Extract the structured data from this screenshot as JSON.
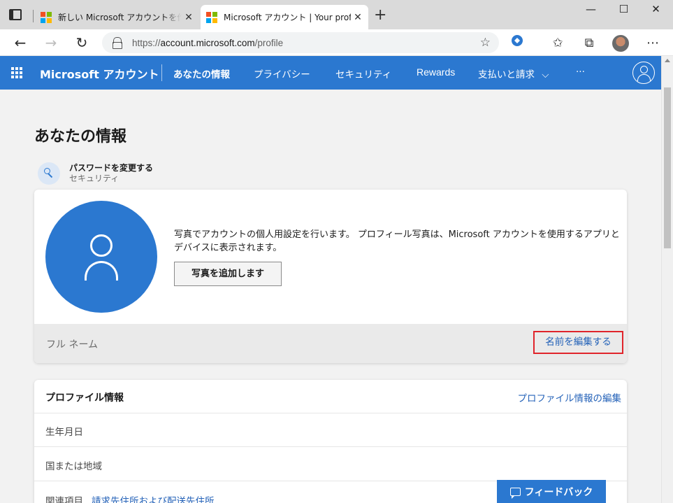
{
  "browser": {
    "tabs": [
      {
        "title": "新しい Microsoft アカウントを作成する",
        "active": false
      },
      {
        "title": "Microsoft アカウント | Your profile",
        "active": true
      }
    ],
    "new_tab": "+",
    "url_scheme": "https://",
    "url_host": "account.microsoft.com",
    "url_path": "/profile",
    "window_buttons": {
      "minimize": "—",
      "maximize": "☐",
      "close": "✕"
    }
  },
  "header": {
    "brand": "Microsoft アカウント",
    "nav": [
      {
        "label": "あなたの情報",
        "current": true
      },
      {
        "label": "プライバシー",
        "current": false
      },
      {
        "label": "セキュリティ",
        "current": false
      },
      {
        "label": "Rewards",
        "current": false
      },
      {
        "label": "支払いと請求",
        "current": false
      }
    ],
    "billing_chevron": "⌵",
    "more": "···"
  },
  "page": {
    "title": "あなたの情報",
    "password_link": {
      "title": "パスワードを変更する",
      "subtitle": "セキュリティ"
    },
    "photo": {
      "description": "写真でアカウントの個人用設定を行います。 プロフィール写真は、Microsoft アカウントを使用するアプリとデバイスに表示されます。",
      "add_button": "写真を追加します"
    },
    "fullname": {
      "label": "フル ネーム",
      "edit_link": "名前を編集する"
    },
    "profile_info": {
      "title": "プロファイル情報",
      "edit_link": "プロファイル情報の編集",
      "rows": [
        "生年月日",
        "国または地域"
      ],
      "related_label": "関連項目",
      "related_link": "請求先住所および配送先住所"
    },
    "feedback_button": "フィードバック"
  },
  "colors": {
    "accent": "#2b78d0",
    "link": "#2462b8",
    "highlight_border": "#e0242b"
  }
}
